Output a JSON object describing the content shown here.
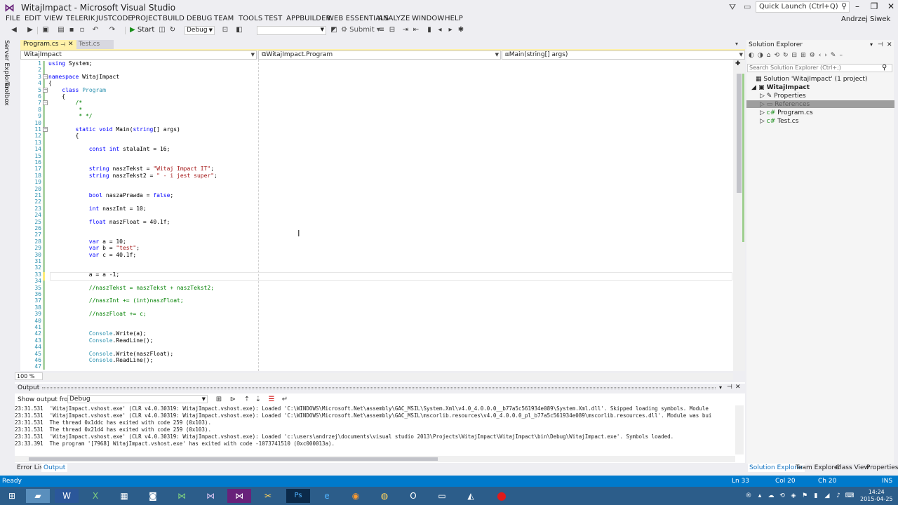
{
  "window": {
    "title": "WitajImpact - Microsoft Visual Studio",
    "quick_launch_placeholder": "Quick Launch (Ctrl+Q)",
    "user": "Andrzej Siwek"
  },
  "menu": [
    "FILE",
    "EDIT",
    "VIEW",
    "TELERIK",
    "JUSTCODE",
    "PROJECT",
    "BUILD",
    "DEBUG",
    "TEAM",
    "TOOLS",
    "TEST",
    "APPBUILDER",
    "WEB ESSENTIALS",
    "ANALYZE",
    "WINDOW",
    "HELP"
  ],
  "toolbar": {
    "start_label": "Start",
    "config_value": "Debug",
    "submit_label": "Submit"
  },
  "side_tabs": [
    "Server Explorer",
    "Toolbox"
  ],
  "doc_tabs": [
    {
      "label": "Program.cs",
      "active": true
    },
    {
      "label": "Test.cs",
      "active": false
    }
  ],
  "nav_bar": {
    "project": "WitajImpact",
    "class": "WitajImpact.Program",
    "member": "Main(string[] args)"
  },
  "editor": {
    "lines": [
      {
        "n": "1",
        "t": "using System;"
      },
      {
        "n": "2",
        "t": ""
      },
      {
        "n": "3",
        "t": "namespace WitajImpact"
      },
      {
        "n": "4",
        "t": "{"
      },
      {
        "n": "5",
        "t": "    class Program"
      },
      {
        "n": "6",
        "t": "    {"
      },
      {
        "n": "7",
        "t": "        /*"
      },
      {
        "n": "8",
        "t": "         *"
      },
      {
        "n": "9",
        "t": "         * */"
      },
      {
        "n": "10",
        "t": ""
      },
      {
        "n": "11",
        "t": "        static void Main(string[] args)"
      },
      {
        "n": "12",
        "t": "        {"
      },
      {
        "n": "13",
        "t": ""
      },
      {
        "n": "14",
        "t": "            const int stalaInt = 16;"
      },
      {
        "n": "15",
        "t": ""
      },
      {
        "n": "16",
        "t": ""
      },
      {
        "n": "17",
        "t": "            string naszTekst = \"Witaj Impact IT\";"
      },
      {
        "n": "18",
        "t": "            string naszTekst2 = \" - i jest super\";"
      },
      {
        "n": "19",
        "t": ""
      },
      {
        "n": "20",
        "t": ""
      },
      {
        "n": "21",
        "t": "            bool naszaPrawda = false;"
      },
      {
        "n": "22",
        "t": ""
      },
      {
        "n": "23",
        "t": "            int naszInt = 10;"
      },
      {
        "n": "24",
        "t": ""
      },
      {
        "n": "25",
        "t": "            float naszFloat = 40.1f;"
      },
      {
        "n": "26",
        "t": ""
      },
      {
        "n": "27",
        "t": ""
      },
      {
        "n": "28",
        "t": "            var a = 10;"
      },
      {
        "n": "29",
        "t": "            var b = \"test\";"
      },
      {
        "n": "30",
        "t": "            var c = 40.1f;"
      },
      {
        "n": "31",
        "t": ""
      },
      {
        "n": "32",
        "t": ""
      },
      {
        "n": "33",
        "t": "            a = a -1;"
      },
      {
        "n": "34",
        "t": ""
      },
      {
        "n": "35",
        "t": "            //naszTekst = naszTekst + naszTekst2;"
      },
      {
        "n": "36",
        "t": ""
      },
      {
        "n": "37",
        "t": "            //naszInt += (int)naszFloat;"
      },
      {
        "n": "38",
        "t": ""
      },
      {
        "n": "39",
        "t": "            //naszFloat += c;"
      },
      {
        "n": "40",
        "t": ""
      },
      {
        "n": "41",
        "t": ""
      },
      {
        "n": "42",
        "t": "            Console.Write(a);"
      },
      {
        "n": "43",
        "t": "            Console.ReadLine();"
      },
      {
        "n": "44",
        "t": ""
      },
      {
        "n": "45",
        "t": "            Console.Write(naszFloat);"
      },
      {
        "n": "46",
        "t": "            Console.ReadLine();"
      },
      {
        "n": "47",
        "t": ""
      }
    ],
    "zoom": "100 %"
  },
  "output": {
    "title": "Output",
    "show_from_label": "Show output from:",
    "show_from_value": "Debug",
    "lines": [
      "23:31.531  'WitajImpact.vshost.exe' (CLR v4.0.30319: WitajImpact.vshost.exe): Loaded 'C:\\WINDOWS\\Microsoft.Net\\assembly\\GAC_MSIL\\System.Xml\\v4.0_4.0.0.0__b77a5c561934e089\\System.Xml.dll'. Skipped loading symbols. Module",
      "23:31.531  'WitajImpact.vshost.exe' (CLR v4.0.30319: WitajImpact.vshost.exe): Loaded 'C:\\WINDOWS\\Microsoft.Net\\assembly\\GAC_MSIL\\mscorlib.resources\\v4.0_4.0.0.0_pl_b77a5c561934e089\\mscorlib.resources.dll'. Module was bui",
      "23:31.531  The thread 0x1ddc has exited with code 259 (0x103).",
      "23:31.531  The thread 0x21d4 has exited with code 259 (0x103).",
      "23:31.531  'WitajImpact.vshost.exe' (CLR v4.0.30319: WitajImpact.vshost.exe): Loaded 'c:\\users\\andrzej\\documents\\visual studio 2013\\Projects\\WitajImpact\\WitajImpact\\bin\\Debug\\WitajImpact.exe'. Symbols loaded.",
      "23:33.391  The program '[7968] WitajImpact.vshost.exe' has exited with code -1073741510 (0xc000013a)."
    ]
  },
  "bottom_tabs": [
    {
      "label": "Error List",
      "active": false
    },
    {
      "label": "Output",
      "active": true
    }
  ],
  "solution_explorer": {
    "title": "Solution Explorer",
    "search_placeholder": "Search Solution Explorer (Ctrl+;)",
    "tree": [
      {
        "label": "Solution 'WitajImpact' (1 project)",
        "level": 0
      },
      {
        "label": "WitajImpact",
        "level": 1
      },
      {
        "label": "Properties",
        "level": 2
      },
      {
        "label": "References",
        "level": 2
      },
      {
        "label": "Program.cs",
        "level": 2
      },
      {
        "label": "Test.cs",
        "level": 2
      }
    ],
    "tabs": [
      {
        "label": "Solution Explorer",
        "active": true
      },
      {
        "label": "Team Explorer",
        "active": false
      },
      {
        "label": "Class View",
        "active": false
      },
      {
        "label": "Properties",
        "active": false
      }
    ]
  },
  "status": {
    "ready": "Ready",
    "ln": "Ln 33",
    "col": "Col 20",
    "ch": "Ch 20",
    "ins": "INS"
  },
  "taskbar": {
    "time": "14:24",
    "date": "2015-04-25"
  }
}
